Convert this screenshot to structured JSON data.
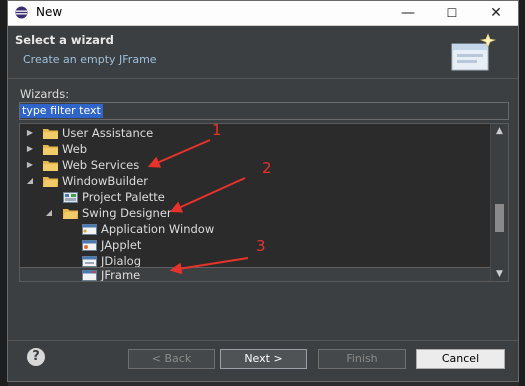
{
  "window": {
    "title": "New",
    "app_icon": "eclipse-icon",
    "minimize": "—",
    "maximize": "☐",
    "close": "✕"
  },
  "banner": {
    "heading": "Select a wizard",
    "description": "Create an empty JFrame",
    "graphic_icon": "new-wizard-icon"
  },
  "wizards": {
    "label": "Wizards:",
    "filter_value": "type filter text"
  },
  "tree": {
    "rows": [
      {
        "label": "User Assistance",
        "icon": "folder-icon",
        "twisty": "expand"
      },
      {
        "label": "Web",
        "icon": "folder-icon",
        "twisty": "expand"
      },
      {
        "label": "Web Services",
        "icon": "folder-icon",
        "twisty": "expand"
      },
      {
        "label": "WindowBuilder",
        "icon": "folder-icon",
        "twisty": "collapse"
      },
      {
        "label": "Project Palette",
        "icon": "palette-icon",
        "twisty": ""
      },
      {
        "label": "Swing Designer",
        "icon": "folder-icon",
        "twisty": "collapse"
      },
      {
        "label": "Application Window",
        "icon": "app-window-icon",
        "twisty": ""
      },
      {
        "label": "JApplet",
        "icon": "japplet-icon",
        "twisty": ""
      },
      {
        "label": "JDialog",
        "icon": "jdialog-icon",
        "twisty": ""
      },
      {
        "label": "JFrame",
        "icon": "jframe-icon",
        "twisty": "",
        "selected": true
      }
    ],
    "scroll_up": "▲",
    "scroll_down": "▼"
  },
  "annotations": [
    "1",
    "2",
    "3"
  ],
  "annotation_color": "#e8322c",
  "buttons": {
    "help": "?",
    "back": "< Back",
    "next": "Next >",
    "finish": "Finish",
    "cancel": "Cancel"
  },
  "colors": {
    "dialog_bg": "#3c3f41",
    "selection": "#2f65ca",
    "title_bar": "#fdfdfd"
  }
}
